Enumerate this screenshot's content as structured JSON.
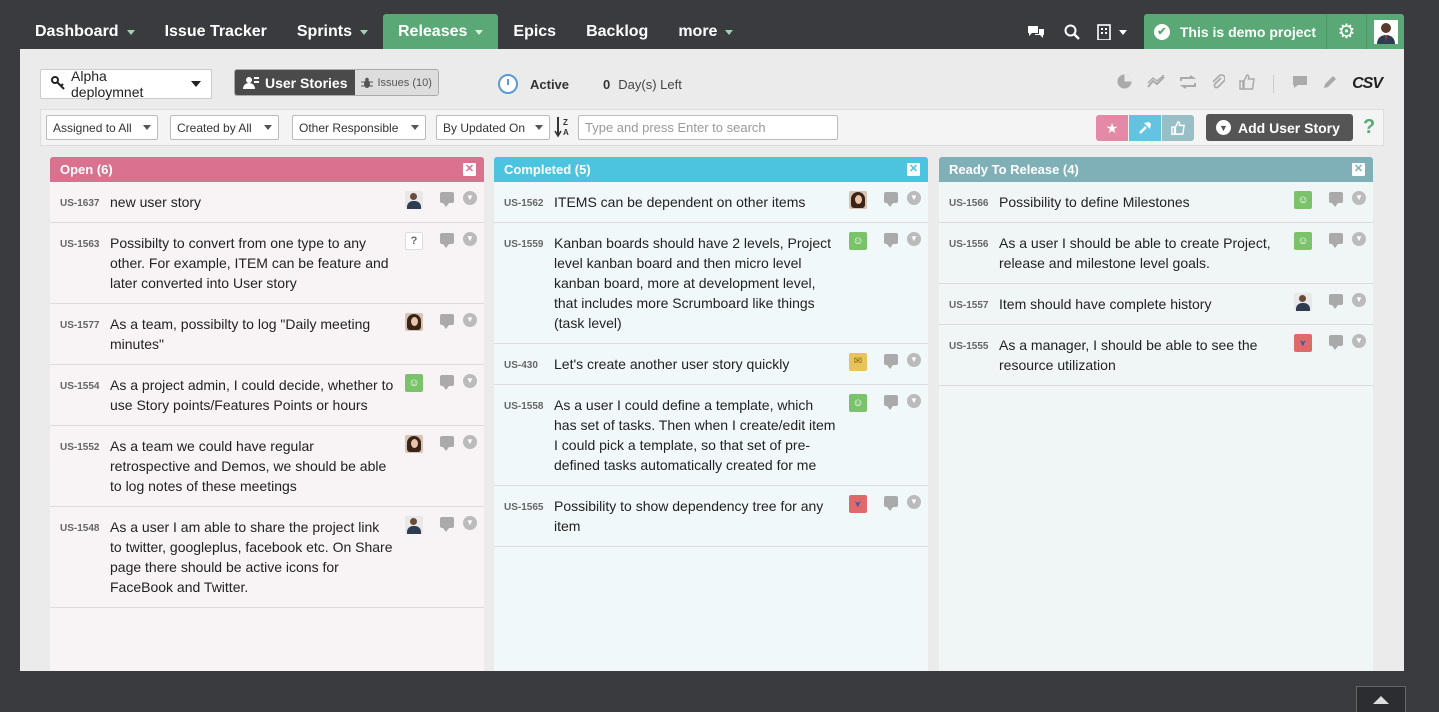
{
  "nav": {
    "items": [
      {
        "label": "Dashboard",
        "has_caret": true,
        "active": false
      },
      {
        "label": "Issue Tracker",
        "has_caret": false,
        "active": false
      },
      {
        "label": "Sprints",
        "has_caret": true,
        "active": false
      },
      {
        "label": "Releases",
        "has_caret": true,
        "active": true
      },
      {
        "label": "Epics",
        "has_caret": false,
        "active": false
      },
      {
        "label": "Backlog",
        "has_caret": false,
        "active": false
      },
      {
        "label": "more",
        "has_caret": true,
        "active": false
      }
    ],
    "icons": [
      "chat-icon",
      "search-icon",
      "building-icon"
    ],
    "demo_badge": "This is demo project",
    "accent_color": "#5aa876"
  },
  "toolbar": {
    "release_name": "Alpha deploymnet",
    "tab_user_stories": "User Stories",
    "tab_issues": "Issues (10)",
    "status": "Active",
    "days_left_num": "0",
    "days_left_label": "Day(s) Left",
    "csv": "CSV"
  },
  "filters": {
    "assigned": "Assigned to All",
    "created": "Created by All",
    "responsible": "Other Responsible",
    "sort": "By Updated On",
    "search_placeholder": "Type and press Enter to search",
    "add_button": "Add User Story",
    "help": "?"
  },
  "columns": [
    {
      "title": "Open (6)",
      "color": "#d9728f",
      "body_color": "#f8f4f5",
      "cards": [
        {
          "id": "US-1637",
          "text": "new user story",
          "avatar": "person"
        },
        {
          "id": "US-1563",
          "text": "Possibilty to convert from one type to any other. For example, ITEM can be feature and later converted into User story",
          "avatar": "unknown"
        },
        {
          "id": "US-1577",
          "text": "As a team, possibilty to log \"Daily meeting minutes\"",
          "avatar": "woman"
        },
        {
          "id": "US-1554",
          "text": "As a project admin, I could decide, whether to use Story points/Features Points or hours",
          "avatar": "green"
        },
        {
          "id": "US-1552",
          "text": "As a team we could have regular retrospective and Demos, we should be able to log notes of these meetings",
          "avatar": "woman"
        },
        {
          "id": "US-1548",
          "text": "As a user I am able to share the project link to twitter, googleplus, facebook etc. On Share page there should be active icons for FaceBook and Twitter.",
          "avatar": "person"
        }
      ]
    },
    {
      "title": "Completed (5)",
      "color": "#4cc4e0",
      "body_color": "#f1f8fa",
      "cards": [
        {
          "id": "US-1562",
          "text": "ITEMS can be dependent on other items",
          "avatar": "woman"
        },
        {
          "id": "US-1559",
          "text": "Kanban boards should have 2 levels, Project level kanban board and then micro level kanban board, more at development level, that includes more Scrumboard like things (task level)",
          "avatar": "green"
        },
        {
          "id": "US-430",
          "text": "Let's create another user story quickly",
          "avatar": "yellow"
        },
        {
          "id": "US-1558",
          "text": "As a user I could define a template, which has set of tasks. Then when I create/edit item I could pick a template, so that set of pre-defined tasks automatically created for me",
          "avatar": "green"
        },
        {
          "id": "US-1565",
          "text": "Possibility to show dependency tree for any item",
          "avatar": "red"
        }
      ]
    },
    {
      "title": "Ready To Release (4)",
      "color": "#7fb0b8",
      "body_color": "#f0f6f6",
      "cards": [
        {
          "id": "US-1566",
          "text": "Possibility to define Milestones",
          "avatar": "green"
        },
        {
          "id": "US-1556",
          "text": "As a user I should be able to create Project, release and milestone level goals.",
          "avatar": "green"
        },
        {
          "id": "US-1557",
          "text": "Item should have complete history",
          "avatar": "person"
        },
        {
          "id": "US-1555",
          "text": "As a manager, I should be able to see the resource utilization",
          "avatar": "red"
        }
      ]
    }
  ]
}
